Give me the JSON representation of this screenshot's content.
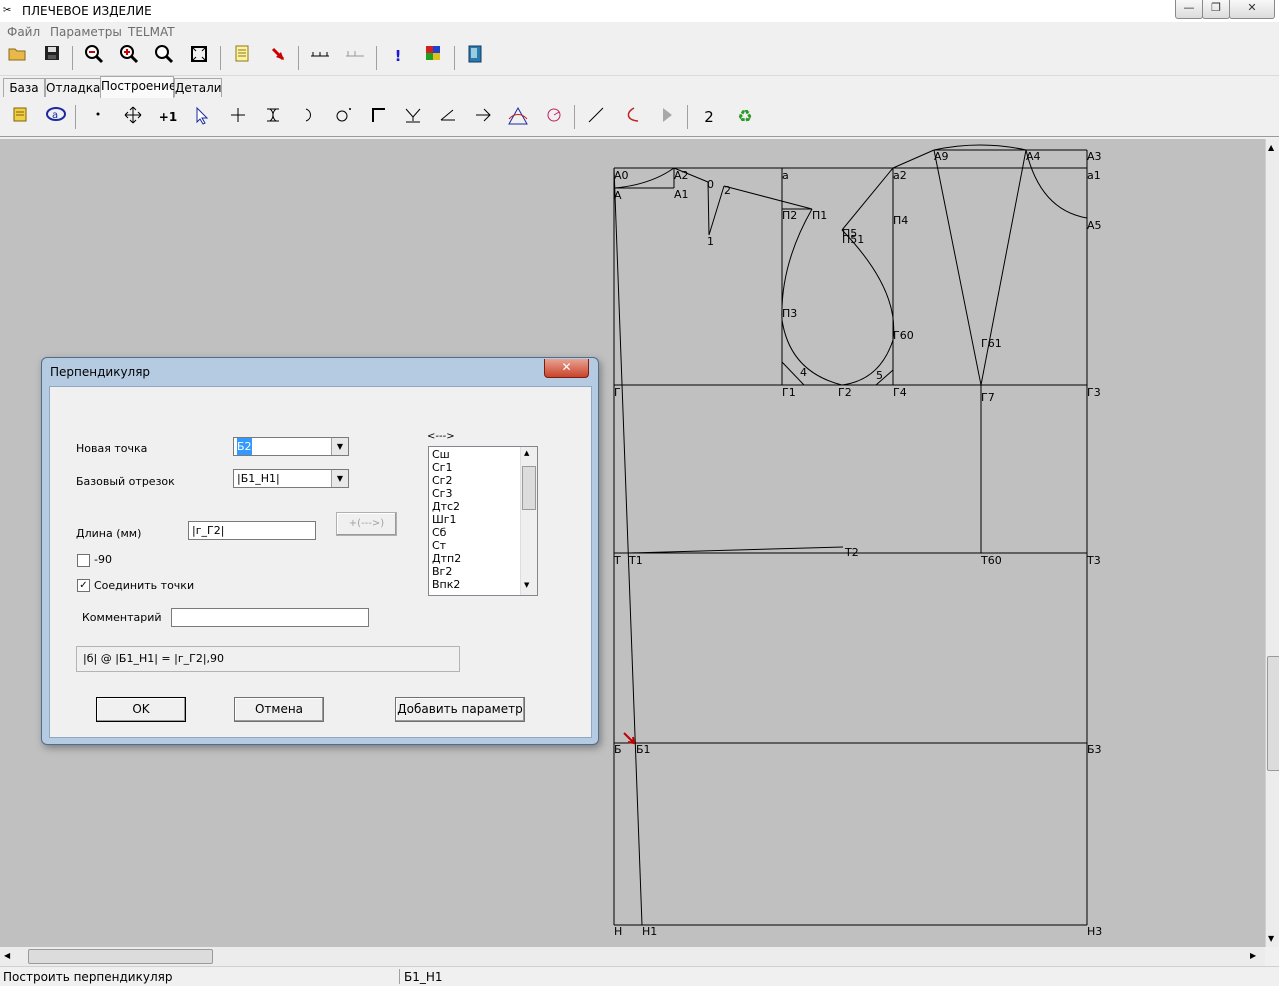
{
  "window": {
    "title": "ПЛЕЧЕВОЕ ИЗДЕЛИЕ",
    "minimize": "—",
    "maximize": "❐",
    "close": "✕"
  },
  "menu": [
    "Файл",
    "Параметры",
    "TELMAT"
  ],
  "tabs": [
    "База",
    "Отладка",
    "Построение",
    "Детали"
  ],
  "active_tab": "Построение",
  "toolbar2": {
    "counter_label": "2"
  },
  "status": {
    "left": "Построить перпендикуляр",
    "right": "Б1_Н1"
  },
  "dialog": {
    "title": "Перпендикуляр",
    "new_point_label": "Новая точка",
    "new_point_value": "Б2",
    "base_segment_label": "Базовый отрезок",
    "base_segment_value": "|Б1_Н1|",
    "length_label": "Длина (мм)",
    "length_value": "|г_Г2|",
    "insert_button": "+(--->)",
    "minus90_label": "-90",
    "minus90_checked": false,
    "connect_label": "Соединить точки",
    "connect_checked": true,
    "comment_label": "Комментарий",
    "comment_value": "",
    "expression": "|б| @ |Б1_Н1| = |г_Г2|,90",
    "ok_button": "OK",
    "cancel_button": "Отмена",
    "add_param_button": "Добавить параметр",
    "list_header": "<--->",
    "list_items": [
      "Сш",
      "Сг1",
      "Сг2",
      "Сг3",
      "Дтс2",
      "Шг1",
      "Сб",
      "Ст",
      "Дтп2",
      "Вг2",
      "Впк2"
    ]
  },
  "drawing": {
    "point_labels": [
      {
        "text": "А0"
      },
      {
        "text": "А2"
      },
      {
        "text": "А"
      },
      {
        "text": "А1"
      },
      {
        "text": "0"
      },
      {
        "text": "2"
      },
      {
        "text": "1"
      },
      {
        "text": "а"
      },
      {
        "text": "а2"
      },
      {
        "text": "А9"
      },
      {
        "text": "А4"
      },
      {
        "text": "А3"
      },
      {
        "text": "а1"
      },
      {
        "text": "А5"
      },
      {
        "text": "П2"
      },
      {
        "text": "П1"
      },
      {
        "text": "П4"
      },
      {
        "text": "П5"
      },
      {
        "text": "П51"
      },
      {
        "text": "П3"
      },
      {
        "text": "Г60"
      },
      {
        "text": "Г61"
      },
      {
        "text": "4"
      },
      {
        "text": "5"
      },
      {
        "text": "Г"
      },
      {
        "text": "Г1"
      },
      {
        "text": "Г2"
      },
      {
        "text": "Г4"
      },
      {
        "text": "Г7"
      },
      {
        "text": "Г3"
      },
      {
        "text": "Т"
      },
      {
        "text": "Т1"
      },
      {
        "text": "Т2"
      },
      {
        "text": "Т60"
      },
      {
        "text": "Т3"
      },
      {
        "text": "Б"
      },
      {
        "text": "Б1"
      },
      {
        "text": "Б3"
      },
      {
        "text": "Н"
      },
      {
        "text": "Н1"
      },
      {
        "text": "Н3"
      }
    ]
  }
}
